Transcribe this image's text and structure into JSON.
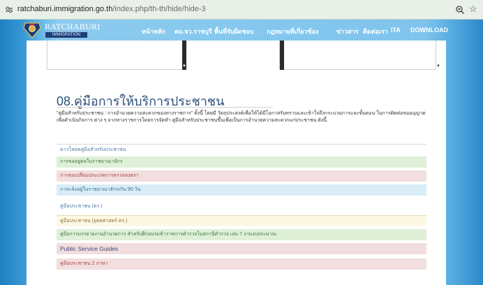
{
  "browser": {
    "url_host": "ratchaburi.immigration.go.th",
    "url_path": "/index.php/th-th/hide/hide-3",
    "site_icon": "site-settings-icon",
    "zoom_icon": "zoom-icon",
    "bookmark_icon": "star-icon"
  },
  "header": {
    "logo_title": "RATCHABURI",
    "logo_subtitle": "IMMIGRATION",
    "nav": [
      "หน้าหลัก",
      "ตม.จว.ราชบุรี",
      "พื้นที่รับผิดชอบ",
      "กฎหมายที่เกี่ยวข้อง",
      "ข่าวสาร",
      "ติดต่อเรา",
      "ITA",
      "DOWNLOAD"
    ]
  },
  "main": {
    "title": "08.คู่มือการให้บริการประชาชน",
    "intro": "\"คู่มือสำหรับประชาชน : การอำนวยความสะดวกของทางราชการ\" ทั้งนี้ โดยมี วัตถุประสงค์เพื่อให้ได้มีโอกาสรับทราบและเข้าใจถึงกระบวนการและขั้นตอน ในการติดต่อขออนุญาตเพื่อดำเนินกิจการ ต่าง ๆ จากทางราชการโดยการจัดทำ คู่มือสำหรับประชาชนขึ้นเพื่อเป็นการอำนวยความสะดวกแก่ประชาชน ดังนี้.",
    "items": [
      {
        "label": "ดาวโหลดคู่มือสำหรับประชาชน",
        "style": "plain"
      },
      {
        "label": "การขออยู่ต่อในราชอาณาจักร",
        "style": "green"
      },
      {
        "label": "การขอเปลี่ยนประเภทการตรวจลงตรา",
        "style": "red"
      },
      {
        "label": "การแจ้งอยู่ในราชอาณาจักรเกิน 90 วัน",
        "style": "blue"
      },
      {
        "label": "คู่มือประชาชน (ตร.)",
        "style": "plain"
      },
      {
        "label": "คู่มือประชาชน (ยุทธศาสตร์ ตร.)",
        "style": "yellow"
      },
      {
        "label": "คู่มือการบรรยายงานอำนวยการ สำหรับฝึกอบรมข้าราชการตำรวจในสถานีตำรวจ เล่ม 7 งานงบประมาณ",
        "style": "green"
      },
      {
        "label": "Public Service Guides",
        "style": "red-big"
      },
      {
        "label": "คู่มือประชาชน 2 ภาษา",
        "style": "red"
      }
    ]
  }
}
